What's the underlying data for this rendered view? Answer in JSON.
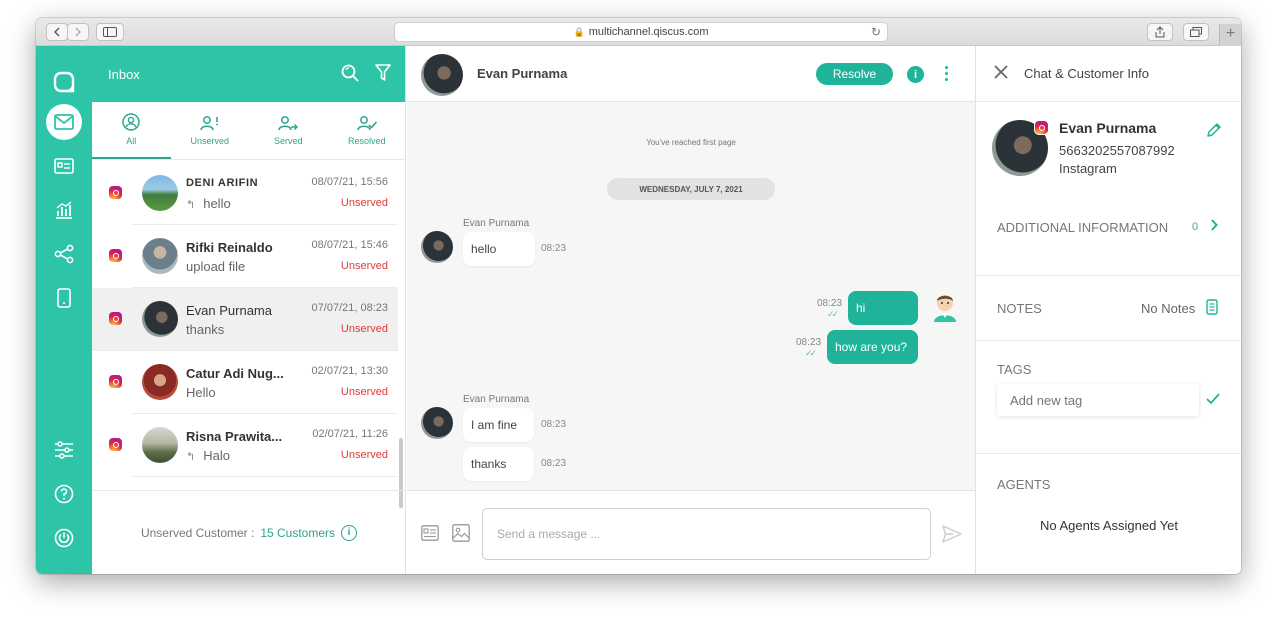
{
  "browser": {
    "url": "multichannel.qiscus.com"
  },
  "inbox": {
    "title": "Inbox",
    "tabs": [
      {
        "label": "All"
      },
      {
        "label": "Unserved"
      },
      {
        "label": "Served"
      },
      {
        "label": "Resolved"
      }
    ],
    "conversations": [
      {
        "name": "DENI ARIFIN",
        "message": "hello",
        "replied": true,
        "time": "08/07/21, 15:56",
        "status": "Unserved"
      },
      {
        "name": "Rifki Reinaldo",
        "message": "upload file",
        "replied": false,
        "time": "08/07/21, 15:46",
        "status": "Unserved"
      },
      {
        "name": "Evan Purnama",
        "message": "thanks",
        "replied": false,
        "time": "07/07/21, 08:23",
        "status": "Unserved"
      },
      {
        "name": "Catur Adi Nug...",
        "message": "Hello",
        "replied": false,
        "time": "02/07/21, 13:30",
        "status": "Unserved"
      },
      {
        "name": "Risna Prawita...",
        "message": "Halo",
        "replied": true,
        "time": "02/07/21, 11:26",
        "status": "Unserved"
      }
    ],
    "footer_label": "Unserved Customer :",
    "footer_count": "15 Customers"
  },
  "chat": {
    "contact_name": "Evan Purnama",
    "resolve_label": "Resolve",
    "first_page_note": "You've reached first page",
    "date_separator": "WEDNESDAY, JULY 7, 2021",
    "messages": [
      {
        "sender": "Evan Purnama",
        "text": "hello",
        "time": "08:23",
        "direction": "in"
      },
      {
        "sender": "",
        "text": "hi",
        "time": "08:23",
        "direction": "out"
      },
      {
        "sender": "",
        "text": "how are you?",
        "time": "08:23",
        "direction": "out"
      },
      {
        "sender": "Evan Purnama",
        "text": "I am fine",
        "time": "08:23",
        "direction": "in"
      },
      {
        "sender": "",
        "text": "thanks",
        "time": "08:23",
        "direction": "in"
      }
    ],
    "composer_placeholder": "Send a message ..."
  },
  "info_panel": {
    "title": "Chat & Customer Info",
    "customer_name": "Evan Purnama",
    "customer_id": "5663202557087992",
    "channel": "Instagram",
    "additional_info_label": "ADDITIONAL INFORMATION",
    "additional_info_count": "0",
    "notes_label": "NOTES",
    "notes_value": "No Notes",
    "tags_label": "TAGS",
    "tag_placeholder": "Add new tag",
    "agents_label": "AGENTS",
    "agents_value": "No Agents Assigned Yet"
  },
  "colors": {
    "accent": "#2ec4a8",
    "unserved": "#e53935"
  }
}
